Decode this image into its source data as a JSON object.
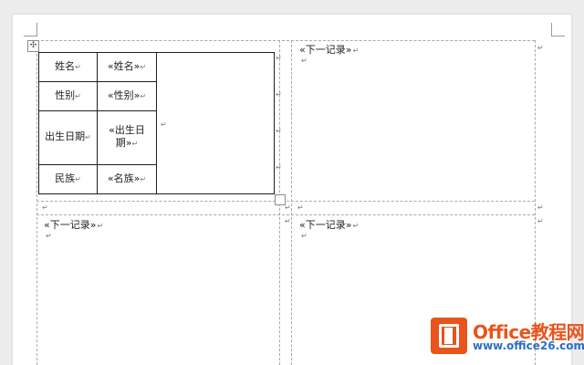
{
  "record_table": {
    "rows": [
      {
        "label": "姓名",
        "field": "«姓名»"
      },
      {
        "label": "性别",
        "field": "«性别»"
      },
      {
        "label": "出生日期",
        "field": "«出生日期»"
      },
      {
        "label": "民族",
        "field": "«名族»"
      }
    ],
    "cell_mark": "↵"
  },
  "labels": {
    "next_record": "«下一记录»",
    "paragraph_mark": "↵",
    "move_handle": "✣"
  },
  "logo": {
    "name": "Office教程网",
    "url": "www.office26.com"
  },
  "colors": {
    "logo_orange": "#e8541b",
    "logo_blue": "#2d6dc7",
    "page_bg": "#ffffff",
    "window_bg": "#ececec"
  }
}
